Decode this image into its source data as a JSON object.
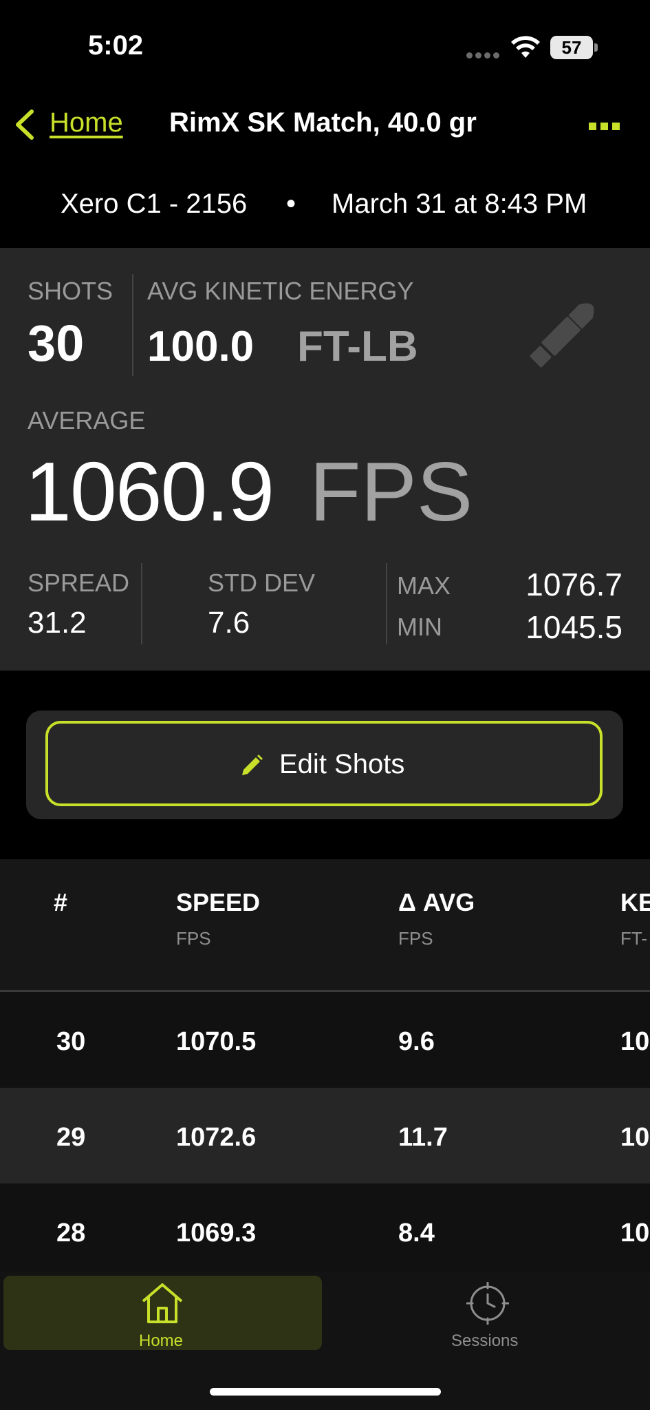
{
  "status_bar": {
    "time": "5:02",
    "battery": "57"
  },
  "nav": {
    "back_label": "Home",
    "title": "RimX SK Match, 40.0 gr"
  },
  "session": {
    "device": "Xero C1 - 2156",
    "separator": "•",
    "date": "March 31 at 8:43 PM"
  },
  "summary": {
    "shots_label": "SHOTS",
    "shots_value": "30",
    "ke_label": "AVG KINETIC ENERGY",
    "ke_value": "100.0",
    "ke_unit": "FT-LB",
    "avg_label": "AVERAGE",
    "avg_value": "1060.9",
    "avg_unit": "FPS",
    "spread_label": "SPREAD",
    "spread_value": "31.2",
    "std_label": "STD DEV",
    "std_value": "7.6",
    "max_label": "MAX",
    "max_value": "1076.7",
    "min_label": "MIN",
    "min_value": "1045.5"
  },
  "edit_button": {
    "label": "Edit Shots"
  },
  "table": {
    "columns": [
      {
        "title": "#",
        "sub": ""
      },
      {
        "title": "SPEED",
        "sub": "FPS"
      },
      {
        "title": "Δ AVG",
        "sub": "FPS"
      },
      {
        "title": "KE",
        "sub": "FT-"
      }
    ],
    "rows": [
      {
        "num": "30",
        "speed": "1070.5",
        "delta": "9.6",
        "ke": "10"
      },
      {
        "num": "29",
        "speed": "1072.6",
        "delta": "11.7",
        "ke": "10"
      },
      {
        "num": "28",
        "speed": "1069.3",
        "delta": "8.4",
        "ke": "10"
      }
    ]
  },
  "tabbar": {
    "tabs": [
      {
        "label": "Home",
        "icon": "home-icon"
      },
      {
        "label": "Sessions",
        "icon": "crosshair-clock-icon"
      }
    ]
  },
  "colors": {
    "accent": "#c8e02a",
    "background": "#000000",
    "panel": "#272727",
    "muted_text": "#9a9a9a"
  }
}
